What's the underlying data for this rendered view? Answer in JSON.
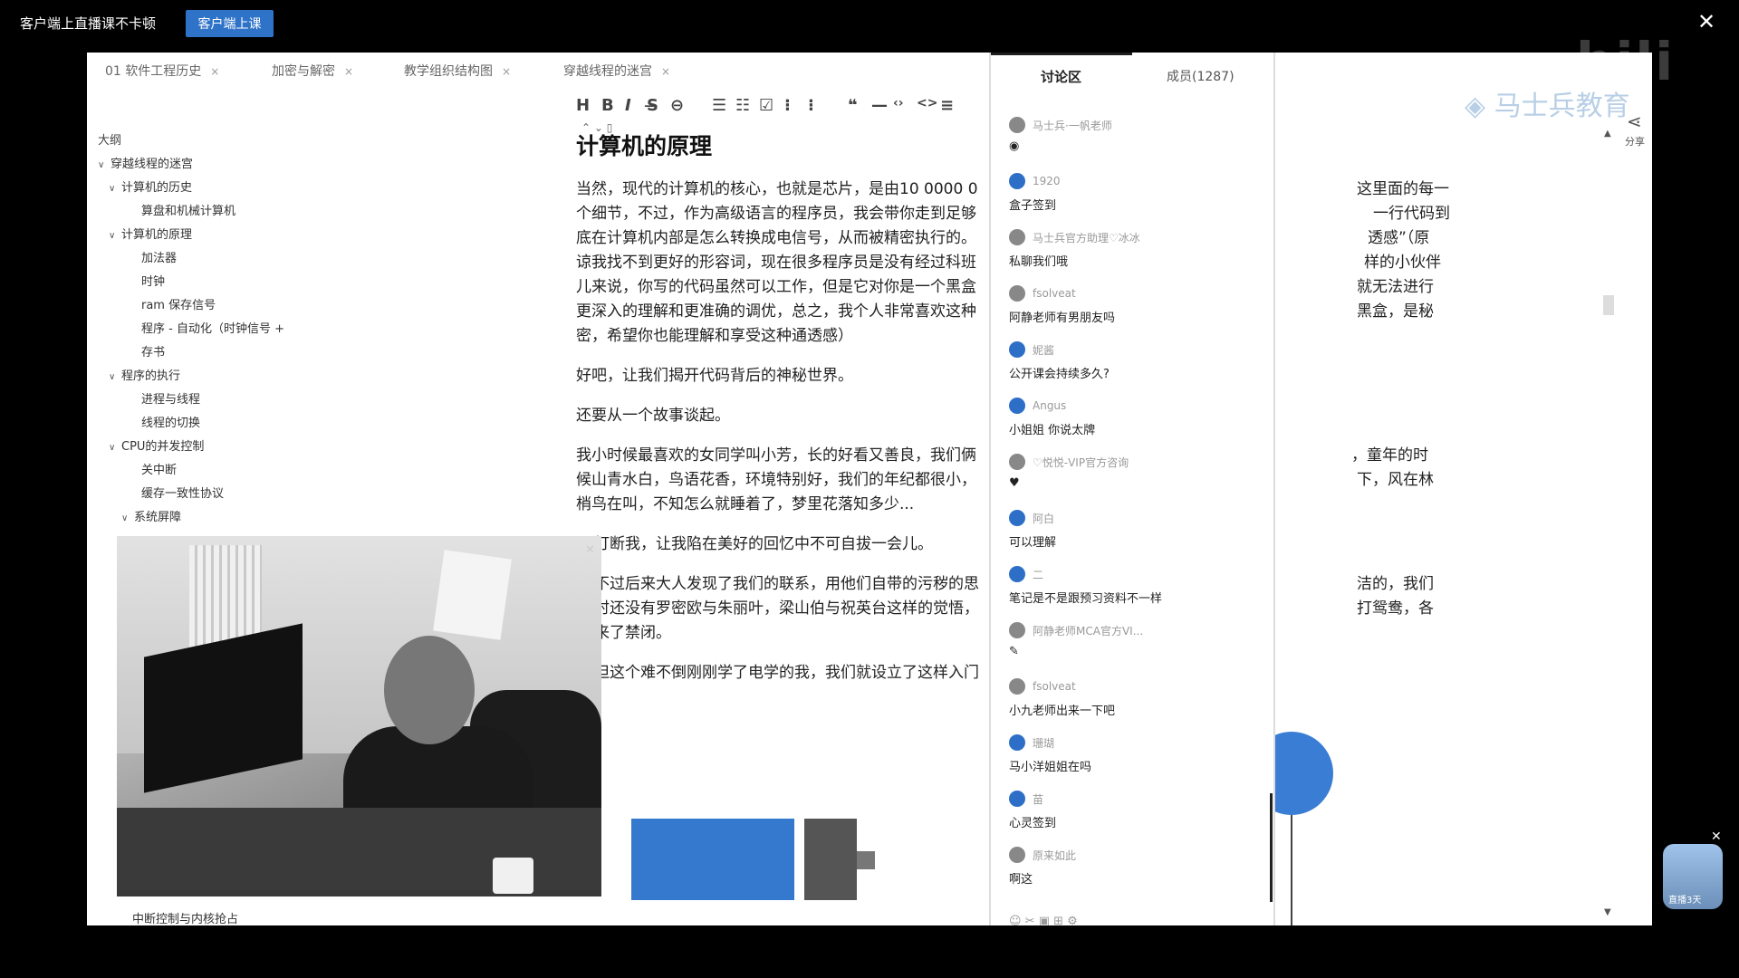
{
  "top": {
    "promo_text": "客户端上直播课不卡顿",
    "promo_button": "客户端上课",
    "close_glyph": "✕",
    "logo_text": "bili"
  },
  "tabs": [
    {
      "label": "01 软件工程历史"
    },
    {
      "label": "加密与解密"
    },
    {
      "label": "教学组织结构图"
    },
    {
      "label": "穿越线程的迷宫"
    }
  ],
  "outline": {
    "title": "大纲",
    "items": [
      {
        "label": "穿越线程的迷宫",
        "caret": "∨"
      },
      {
        "label": "计算机的历史",
        "caret": "∨"
      },
      {
        "label": "算盘和机械计算机",
        "caret": ""
      },
      {
        "label": "计算机的原理",
        "caret": "∨"
      },
      {
        "label": "加法器",
        "caret": ""
      },
      {
        "label": "时钟",
        "caret": ""
      },
      {
        "label": "ram 保存信号",
        "caret": ""
      },
      {
        "label": "程序 - 自动化（时钟信号 +",
        "caret": ""
      },
      {
        "label": "存书",
        "caret": ""
      },
      {
        "label": "程序的执行",
        "caret": "∨"
      },
      {
        "label": "进程与线程",
        "caret": ""
      },
      {
        "label": "线程的切换",
        "caret": ""
      },
      {
        "label": "CPU的并发控制",
        "caret": "∨"
      },
      {
        "label": "关中断",
        "caret": ""
      },
      {
        "label": "缓存一致性协议",
        "caret": ""
      },
      {
        "label": "系统屏障",
        "caret": "∨"
      }
    ],
    "bottom_item": "中断控制与内核抢占"
  },
  "toolbar": {
    "buttons": [
      "H",
      "B",
      "I",
      "S̶",
      "⊖",
      "☰",
      "☷",
      "☑",
      "⁝",
      "⁝",
      "❝",
      "—",
      "‹›",
      "<>",
      "≡"
    ],
    "row2": "⌃ ⌄ ▯"
  },
  "doc": {
    "title": "计算机的原理",
    "paragraphs": [
      "当然，现代的计算机的核心，也就是芯片，是由10 0000 0",
      "个细节，不过，作为高级语言的程序员，我会带你走到足够",
      "底在计算机内部是怎么转换成电信号，从而被精密执行的。",
      "谅我找不到更好的形容词，现在很多程序员是没有经过科班",
      "儿来说，你写的代码虽然可以工作，但是它对你是一个黑盒",
      "更深入的理解和更准确的调优，总之，我个人非常喜欢这种",
      "密，希望你也能理解和享受这种通透感）",
      "好吧，让我们揭开代码背后的神秘世界。",
      "还要从一个故事谈起。",
      "我小时候最喜欢的女同学叫小芳，长的好看又善良，我们俩",
      "候山青水白，鸟语花香，环境特别好，我们的年纪都很小，",
      "梢鸟在叫，不知怎么就睡着了，梦里花落知多少...",
      "打断我，让我陷在美好的回忆中不可自拔一会儿。",
      "不过后来大人发现了我们的联系，用他们自带的污秽的思",
      "时还没有罗密欧与朱丽叶，梁山伯与祝英台这样的觉悟，",
      "来了禁闭。",
      "但这个难不倒刚刚学了电学的我，我们就设立了这样入门"
    ],
    "right_fragments": [
      "这里面的每一",
      "一行代码到",
      "透感”（原",
      "样的小伙伴",
      "就无法进行",
      "黑盒，是秘",
      "，童年的时",
      "下，风在林",
      "洁的，我们",
      "打鸳鸯，各"
    ]
  },
  "battery": {
    "minus": "-",
    "plus": "+"
  },
  "chat": {
    "tab_discussion": "讨论区",
    "tab_members": "成员(1287)",
    "messages": [
      {
        "user": "马士兵·一帆老师",
        "text": "◉",
        "avatar": "gray"
      },
      {
        "user": "1920",
        "text": "盒子签到",
        "avatar": "blue"
      },
      {
        "user": "马士兵官方助理♡冰冰",
        "text": "私聊我们哦",
        "avatar": "gray"
      },
      {
        "user": "fsolveat",
        "text": "阿静老师有男朋友吗",
        "avatar": "gray"
      },
      {
        "user": "妮酱",
        "text": "公开课会持续多久?",
        "avatar": "blue"
      },
      {
        "user": "Angus",
        "text": "小姐姐 你说太牌",
        "avatar": "blue"
      },
      {
        "user": "♡悦悦-VIP官方咨询",
        "text": "♥",
        "avatar": "gray"
      },
      {
        "user": "阿白",
        "text": "可以理解",
        "avatar": "blue"
      },
      {
        "user": "二",
        "text": "笔记是不是跟预习资料不一样",
        "avatar": "blue"
      },
      {
        "user": "阿静老师MCA官方VI...",
        "text": "✎",
        "avatar": "gray"
      },
      {
        "user": "fsolveat",
        "text": "小九老师出来一下吧",
        "avatar": "gray"
      },
      {
        "user": "珊瑚",
        "text": "马小洋姐姐在吗",
        "avatar": "blue"
      },
      {
        "user": "苗",
        "text": "心灵签到",
        "avatar": "blue"
      },
      {
        "user": "原来如此",
        "text": "啊这",
        "avatar": "gray"
      }
    ],
    "bottom_icons": "☺ ✂ ▣          ⊞ ⚙"
  },
  "right_panel": {
    "share_icon": "⋖",
    "share_label": "分享",
    "chev_up": "▲",
    "chev_down": "▼",
    "watermark": "◈ 马士兵教育"
  },
  "mascot": {
    "label": "直播3天",
    "close": "✕"
  },
  "video": {
    "close": "✕"
  }
}
